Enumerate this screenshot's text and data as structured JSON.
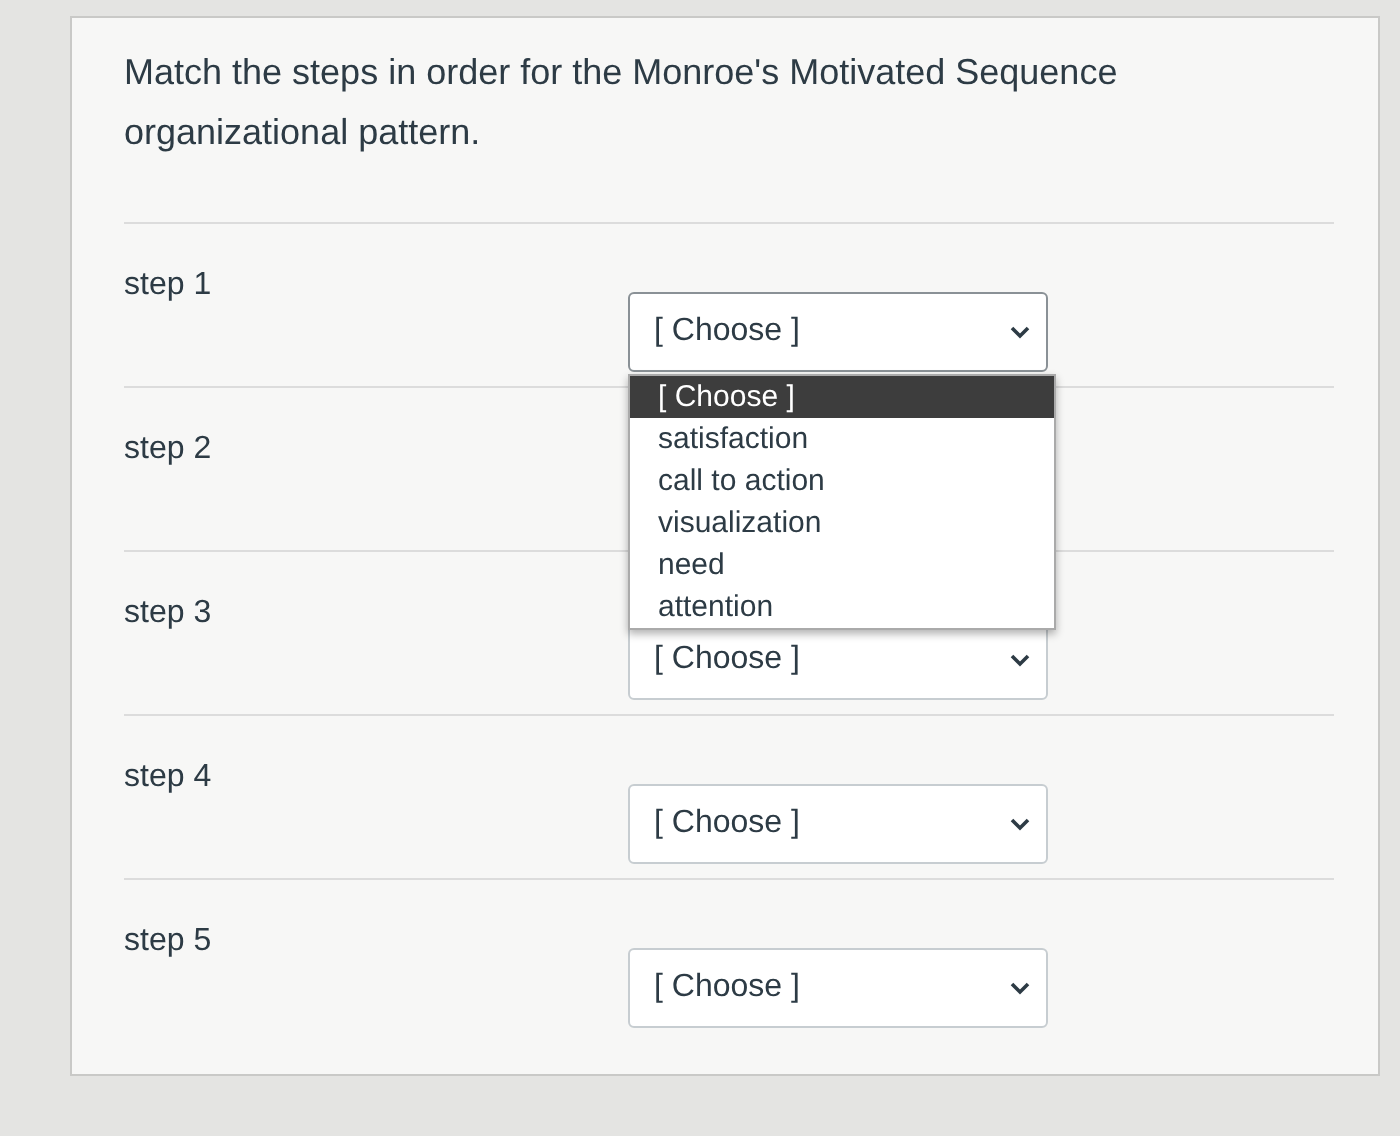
{
  "question": "Match the steps in order for the Monroe's Motivated Sequence organizational pattern.",
  "rows": [
    {
      "label": "step 1",
      "select": {
        "value": "[ Choose ]",
        "open": true,
        "options": [
          {
            "label": "[ Choose ]",
            "selected": true
          },
          {
            "label": "satisfaction",
            "selected": false
          },
          {
            "label": "call to action",
            "selected": false
          },
          {
            "label": "visualization",
            "selected": false
          },
          {
            "label": "need",
            "selected": false
          },
          {
            "label": "attention",
            "selected": false
          }
        ]
      }
    },
    {
      "label": "step 2"
    },
    {
      "label": "step 3",
      "select": {
        "value": "[ Choose ]",
        "open": false
      }
    },
    {
      "label": "step 4",
      "select": {
        "value": "[ Choose ]",
        "open": false
      }
    },
    {
      "label": "step 5",
      "select": {
        "value": "[ Choose ]",
        "open": false
      }
    }
  ]
}
